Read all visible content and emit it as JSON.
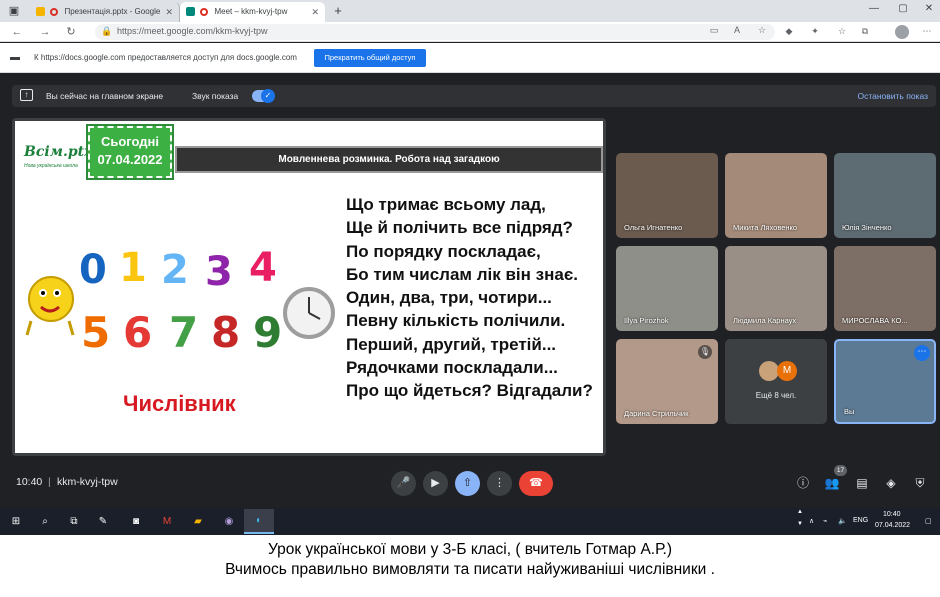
{
  "browser": {
    "tabs": [
      {
        "title": "Презентація.pptx - Google",
        "favicon_color": "#f4b400",
        "active": false
      },
      {
        "title": "Meet – kkm-kvyj-tpw",
        "favicon_color": "#00897b",
        "active": true
      }
    ],
    "new_tab_label": "+",
    "address_url": "https://meet.google.com/kkm-kvyj-tpw"
  },
  "share_notice": {
    "text": "К https://docs.google.com предоставляется доступ для docs.google.com",
    "stop_button": "Прекратить общий доступ"
  },
  "presenting_bar": {
    "status": "Вы сейчас на главном экране",
    "sound_label": "Звук показа",
    "sound_on": true,
    "stop_label": "Остановить показ"
  },
  "slide": {
    "logo_main": "Всім.ptx",
    "logo_sub": "Нова українська школа",
    "date_line1": "Сьогодні",
    "date_line2": "07.04.2022",
    "header": "Мовленнева розминка. Робота над загадкою",
    "digits": [
      "0",
      "1",
      "2",
      "3",
      "4",
      "5",
      "6",
      "7",
      "8",
      "9"
    ],
    "word": "Числівник",
    "riddle": [
      "Що тримає всьому лад,",
      "Ще й полічить все підряд?",
      "По порядку поскладає,",
      "Бо тим числам лік він знає.",
      "Один, два, три, чотири...",
      "Певну кількість полічили.",
      "Перший, другий, третій...",
      "Рядочками поскладали...",
      "Про що йдеться? Відгадали?"
    ]
  },
  "participants": [
    {
      "name": "Ольга Игнатенко",
      "color": "#6b5a4e"
    },
    {
      "name": "Микита Ляховенко",
      "color": "#a48a78"
    },
    {
      "name": "Юлія Зінченко",
      "color": "#5d6b72"
    },
    {
      "name": "Illya Pirozhok",
      "color": "#8f8f8a"
    },
    {
      "name": "Людмила Карнаух",
      "color": "#9a8f86"
    },
    {
      "name": "МИРОСЛАВА КО...",
      "color": "#7e6f66"
    },
    {
      "name": "Дарина Стрильчик",
      "color": "#b2998a",
      "muted": true
    },
    {
      "name": "Вы",
      "color": "#5d7a94",
      "self": true
    }
  ],
  "more_participants": {
    "label": "Ещё 8 чел.",
    "avatar_letter": "М"
  },
  "meeting": {
    "time": "10:40",
    "separator": "|",
    "code": "kkm-kvyj-tpw",
    "people_count": "17"
  },
  "taskbar": {
    "time": "10:40",
    "date": "07.04.2022",
    "lang": "ENG"
  },
  "caption": {
    "line1": "Урок української мови у 3-Б класі, ( вчитель Готмар А.Р.)",
    "line2": "Вчимось правильно вимовляти та писати найуживаніші числівники ."
  },
  "colors": {
    "meet_bg": "#202124",
    "accent_blue": "#1a73e8",
    "end_red": "#ea4335",
    "slide_title_red": "#d71921"
  }
}
